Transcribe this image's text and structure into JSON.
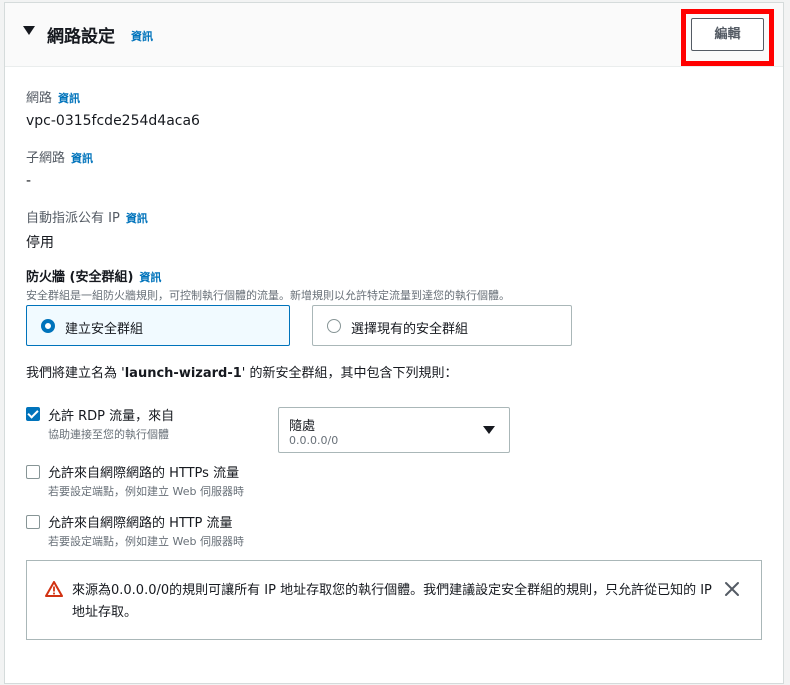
{
  "section": {
    "title": "網路設定",
    "info": "資訊",
    "edit_label": "編輯"
  },
  "network": {
    "label": "網路",
    "info": "資訊",
    "value": "vpc-0315fcde254d4aca6"
  },
  "subnet": {
    "label": "子網路",
    "info": "資訊",
    "value": "-"
  },
  "auto_ip": {
    "label": "自動指派公有 IP",
    "info": "資訊",
    "value": "停用"
  },
  "firewall": {
    "label": "防火牆 (安全群組)",
    "info": "資訊",
    "description": "安全群組是一組防火牆規則，可控制執行個體的流量。新增規則以允許特定流量到達您的執行個體。",
    "options": [
      {
        "label": "建立安全群組",
        "selected": true
      },
      {
        "label": "選擇現有的安全群組",
        "selected": false
      }
    ]
  },
  "rule_note": {
    "prefix": "我們將建立名為 '",
    "name": "launch-wizard-1",
    "suffix": "' 的新安全群組，其中包含下列規則："
  },
  "rules": [
    {
      "label": "允許 RDP 流量，來自",
      "sub": "協助連接至您的執行個體",
      "checked": true
    },
    {
      "label": "允許來自網際網路的 HTTPs 流量",
      "sub": "若要設定端點，例如建立 Web 伺服器時",
      "checked": false
    },
    {
      "label": "允許來自網際網路的 HTTP 流量",
      "sub": "若要設定端點，例如建立 Web 伺服器時",
      "checked": false
    }
  ],
  "source_select": {
    "value": "隨處",
    "sub": "0.0.0.0/0"
  },
  "alert": {
    "text": "來源為0.0.0.0/0的規則可讓所有 IP 地址存取您的執行個體。我們建議設定安全群組的規則，只允許從已知的 IP 地址存取。"
  },
  "colors": {
    "accent": "#0073bb",
    "highlight": "#ff0000",
    "warning": "#d13212"
  }
}
